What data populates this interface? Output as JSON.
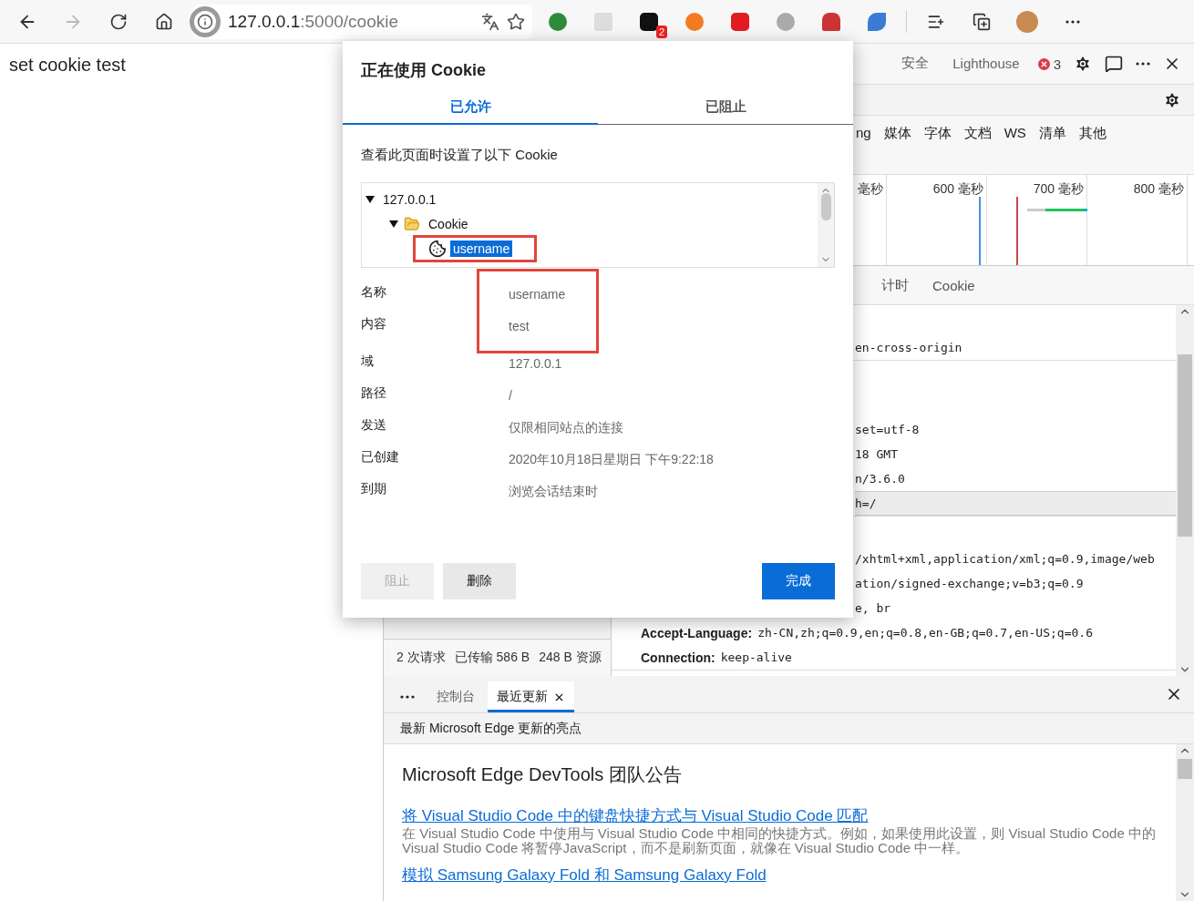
{
  "browser": {
    "forward_disabled": true,
    "address": {
      "host": "127.0.0.1",
      "path": ":5000/cookie"
    },
    "extension_badge": "2"
  },
  "page": {
    "text": "set cookie test"
  },
  "devtools": {
    "tabs": [
      {
        "label": "安全",
        "selected": false
      },
      {
        "label": "Lighthouse",
        "selected": false
      }
    ],
    "error_count": "3",
    "filters": [
      "ng",
      "媒体",
      "字体",
      "文档",
      "WS",
      "清单",
      "其他"
    ],
    "timeline": {
      "ticks": [
        "毫秒",
        "600 毫秒",
        "700 毫秒",
        "800 毫秒"
      ]
    },
    "detail_tabs": [
      {
        "label": "计时",
        "selected": false
      },
      {
        "label": "Cookie",
        "selected": false
      }
    ],
    "sections": [
      {
        "lines": [
          {
            "kind": "fragment",
            "text": "en-cross-origin",
            "highlighted": false
          }
        ]
      },
      {
        "lines": [
          {
            "kind": "fragment",
            "text": "set=utf-8",
            "highlighted": false
          },
          {
            "kind": "fragment",
            "text": "18 GMT",
            "highlighted": false
          },
          {
            "kind": "fragment",
            "text": "n/3.6.0",
            "highlighted": false
          },
          {
            "kind": "fragment",
            "text": "h=/",
            "highlighted": true
          }
        ]
      },
      {
        "lines": [
          {
            "kind": "fragment",
            "text": "/xhtml+xml,application/xml;q=0.9,image/web",
            "highlighted": false
          },
          {
            "kind": "fragment",
            "text": "ation/signed-exchange;v=b3;q=0.9",
            "highlighted": false
          },
          {
            "kind": "fragment",
            "text": "e, br",
            "highlighted": false
          },
          {
            "kind": "header",
            "name": "Accept-Language:",
            "value": "zh-CN,zh;q=0.9,en;q=0.8,en-GB;q=0.7,en-US;q=0.6"
          },
          {
            "kind": "header",
            "name": "Connection:",
            "value": "keep-alive"
          }
        ]
      }
    ],
    "status": [
      "2 次请求",
      "已传输 586 B",
      "248 B 资源"
    ]
  },
  "drawer": {
    "tabs": [
      {
        "label": "控制台",
        "selected": false,
        "closable": false
      },
      {
        "label": "最近更新",
        "selected": true,
        "closable": true
      }
    ],
    "subtitle": "最新 Microsoft Edge 更新的亮点",
    "heading": "Microsoft Edge DevTools 团队公告",
    "articles": [
      {
        "link": "将 Visual Studio Code 中的键盘快捷方式与 Visual Studio Code 匹配",
        "description": "在 Visual Studio Code 中使用与 Visual Studio Code 中相同的快捷方式。例如，如果使用此设置，则 Visual Studio Code 中的 Visual Studio Code 将暂停JavaScript，而不是刷新页面，就像在 Visual Studio Code 中一样。"
      },
      {
        "link": "模拟 Samsung Galaxy Fold 和 Samsung Galaxy Fold"
      }
    ]
  },
  "dialog": {
    "title": "正在使用 Cookie",
    "tabs": [
      {
        "label": "已允许",
        "selected": true
      },
      {
        "label": "已阻止",
        "selected": false
      }
    ],
    "intro": "查看此页面时设置了以下 Cookie",
    "tree": [
      {
        "label": "127.0.0.1",
        "selected": false,
        "expanded": true,
        "children": [
          {
            "label": "Cookie",
            "kind": "folder",
            "selected": false,
            "expanded": true,
            "children": [
              {
                "label": "username",
                "kind": "cookie",
                "selected": true,
                "annotated": true
              }
            ]
          }
        ]
      }
    ],
    "details": [
      {
        "annotated": true,
        "rows": [
          {
            "label": "名称",
            "value": "username"
          },
          {
            "label": "内容",
            "value": "test"
          }
        ]
      },
      {
        "annotated": false,
        "rows": [
          {
            "label": "域",
            "value": "127.0.0.1"
          },
          {
            "label": "路径",
            "value": "/"
          },
          {
            "label": "发送",
            "value": "仅限相同站点的连接"
          },
          {
            "label": "已创建",
            "value": "2020年10月18日星期日 下午9:22:18"
          },
          {
            "label": "到期",
            "value": "浏览会话结束时"
          }
        ]
      }
    ],
    "buttons": [
      {
        "label": "阻止",
        "kind": "secondary",
        "disabled": true
      },
      {
        "label": "删除",
        "kind": "secondary",
        "disabled": false
      },
      {
        "label": "完成",
        "kind": "primary",
        "disabled": false
      }
    ]
  }
}
